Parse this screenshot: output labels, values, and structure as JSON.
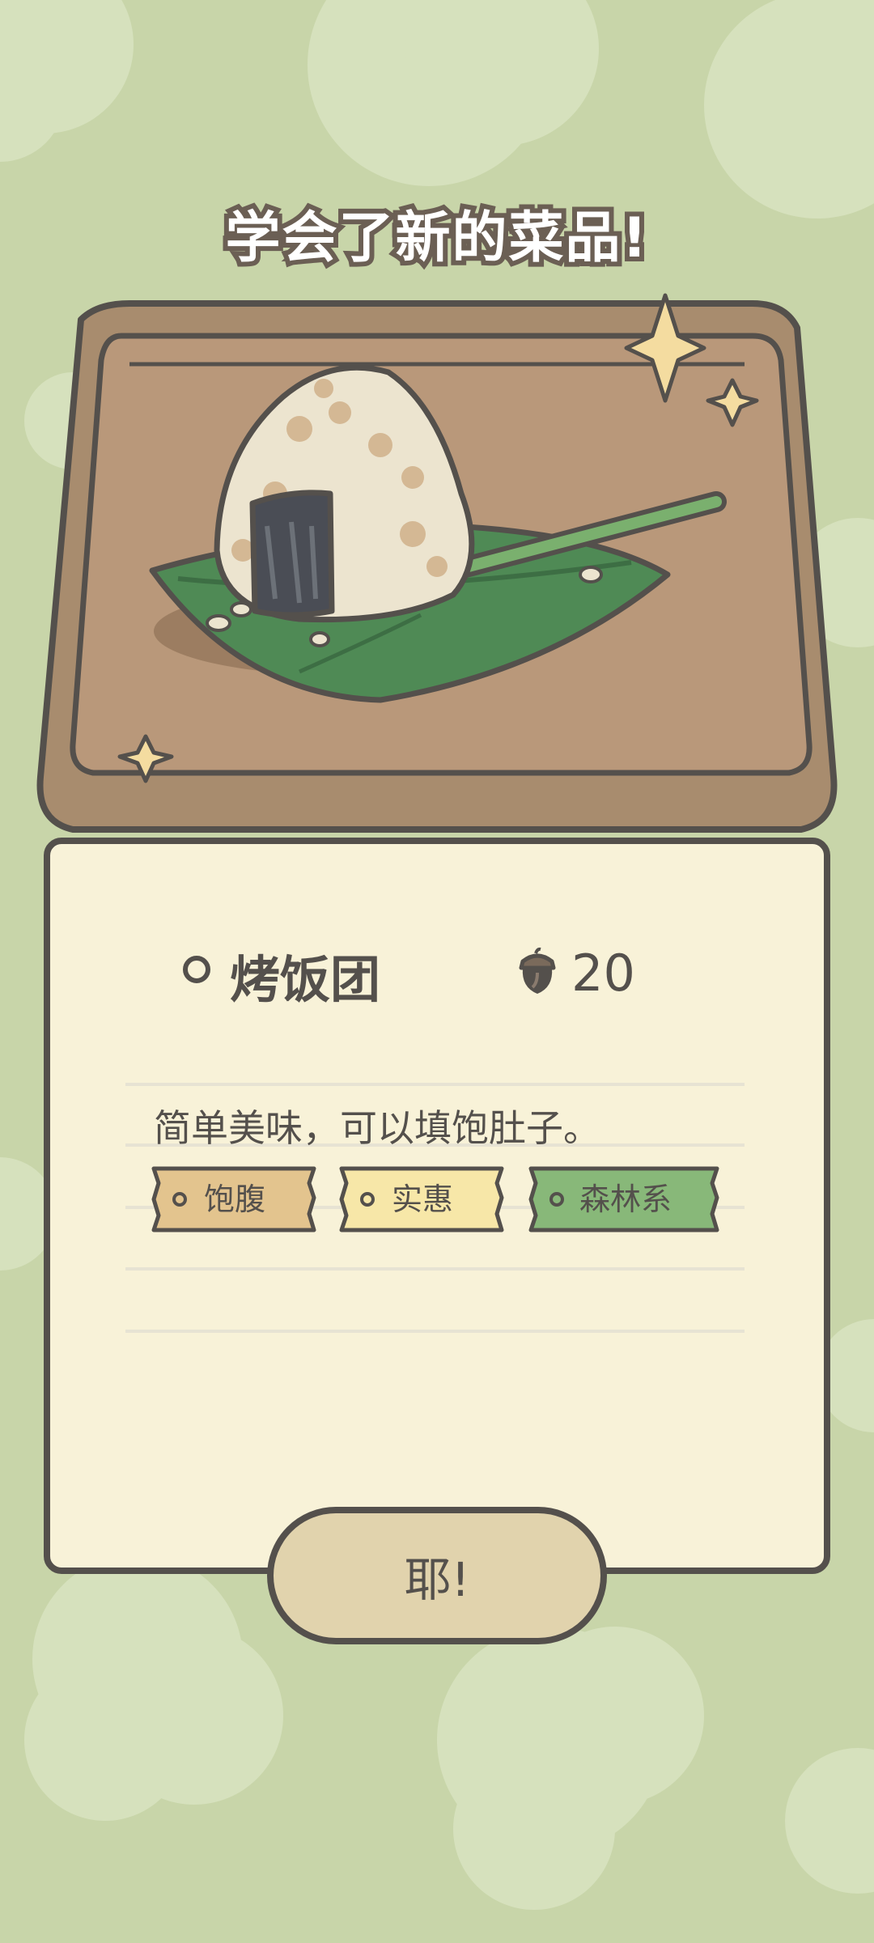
{
  "screen_title": "学会了新的菜品!",
  "dish": {
    "name": "烤饭团",
    "price": "20",
    "price_icon": "acorn-icon",
    "description": "简单美味，可以填饱肚子。"
  },
  "tags": [
    {
      "label": "饱腹",
      "color": "#e3c48e"
    },
    {
      "label": "实惠",
      "color": "#f7e7a8"
    },
    {
      "label": "森林系",
      "color": "#88b879"
    }
  ],
  "confirm_button": "耶!",
  "colors": {
    "background": "#c8d5a9",
    "card": "#f8f2d8",
    "outline": "#54504c",
    "button": "#e1d3ad"
  }
}
